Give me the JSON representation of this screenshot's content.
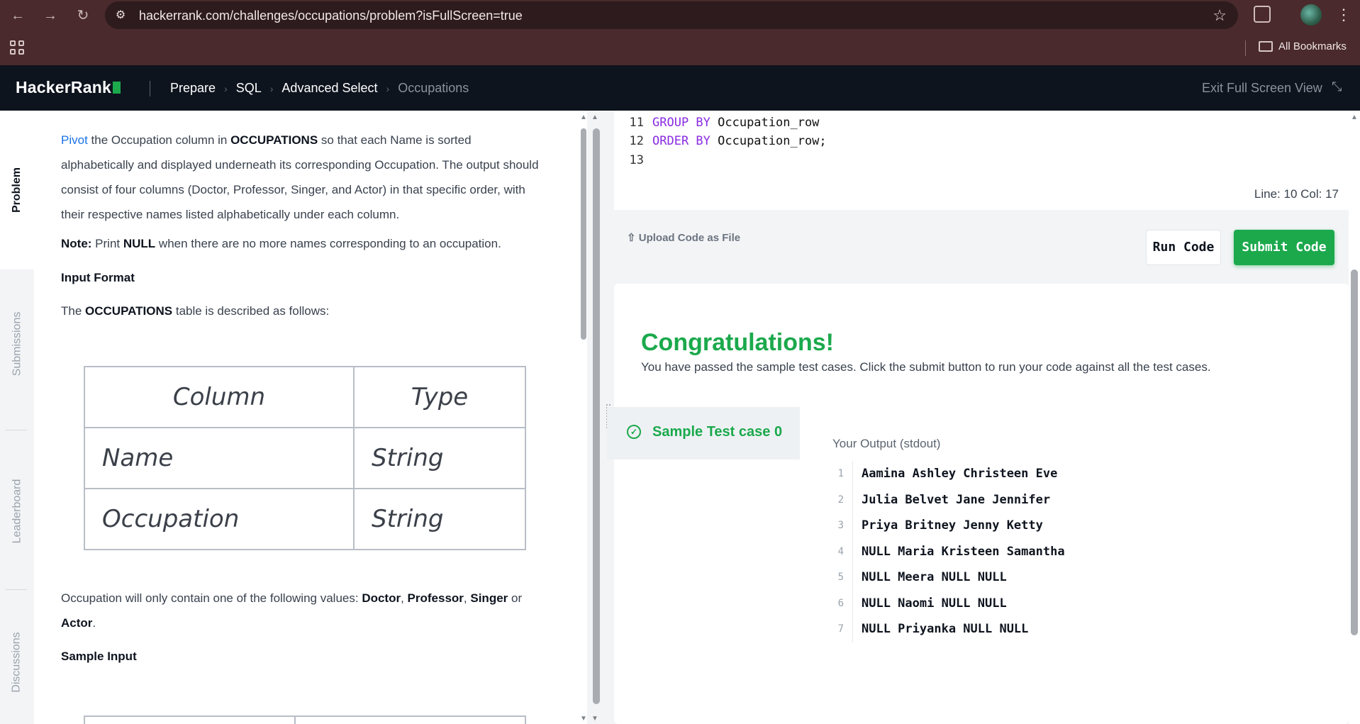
{
  "browser": {
    "url": "hackerrank.com/challenges/occupations/problem?isFullScreen=true",
    "all_bookmarks": "All Bookmarks"
  },
  "header": {
    "logo": "HackerRank",
    "breadcrumbs": [
      "Prepare",
      "SQL",
      "Advanced Select",
      "Occupations"
    ],
    "exit_fullscreen": "Exit Full Screen View"
  },
  "tabs": [
    "Problem",
    "Submissions",
    "Leaderboard",
    "Discussions"
  ],
  "problem": {
    "intro_link": "Pivot",
    "intro_1": " the Occupation column in ",
    "intro_bold": "OCCUPATIONS",
    "intro_2": " so that each Name is sorted alphabetically and displayed underneath its corresponding Occupation. The output should consist of four columns (Doctor, Professor, Singer, and Actor) in that specific order, with their respective names listed alphabetically under each column.",
    "note_label": "Note:",
    "note_1": " Print ",
    "note_bold": "NULL",
    "note_2": " when there are no more names corresponding to an occupation.",
    "input_format": "Input Format",
    "table_desc_1": "The ",
    "table_desc_bold": "OCCUPATIONS",
    "table_desc_2": " table is described as follows:",
    "table": {
      "headers": [
        "Column",
        "Type"
      ],
      "rows": [
        [
          "Name",
          "String"
        ],
        [
          "Occupation",
          "String"
        ]
      ]
    },
    "values_1": "Occupation will only contain one of the following values: ",
    "values_list": [
      "Doctor",
      "Professor",
      "Singer",
      "Actor"
    ],
    "values_sep": [
      ", ",
      ", ",
      " or "
    ],
    "values_end": ".",
    "sample_input": "Sample Input"
  },
  "editor": {
    "lines": [
      {
        "num": "11",
        "kw": "GROUP BY",
        "code": " Occupation_row"
      },
      {
        "num": "12",
        "kw": "ORDER BY",
        "code": " Occupation_row;"
      },
      {
        "num": "13",
        "kw": "",
        "code": ""
      }
    ],
    "status": "Line: 10 Col: 17"
  },
  "actions": {
    "upload": "Upload Code as File",
    "run": "Run Code",
    "submit": "Submit Code"
  },
  "result": {
    "title": "Congratulations!",
    "message": "You have passed the sample test cases. Click the submit button to run your code against all the test cases.",
    "testcase": "Sample Test case 0",
    "output_title": "Your Output (stdout)",
    "output": [
      {
        "n": "1",
        "text": "Aamina Ashley Christeen Eve"
      },
      {
        "n": "2",
        "text": "Julia Belvet Jane Jennifer"
      },
      {
        "n": "3",
        "text": "Priya Britney Jenny Ketty"
      },
      {
        "n": "4",
        "text": "NULL Maria Kristeen Samantha"
      },
      {
        "n": "5",
        "text": "NULL Meera NULL NULL"
      },
      {
        "n": "6",
        "text": "NULL Naomi NULL NULL"
      },
      {
        "n": "7",
        "text": "NULL Priyanka NULL NULL"
      }
    ]
  },
  "colors": {
    "brand_green": "#1ba94c",
    "header_bg": "#0e141e",
    "browser_bg": "#4a2a2c"
  }
}
